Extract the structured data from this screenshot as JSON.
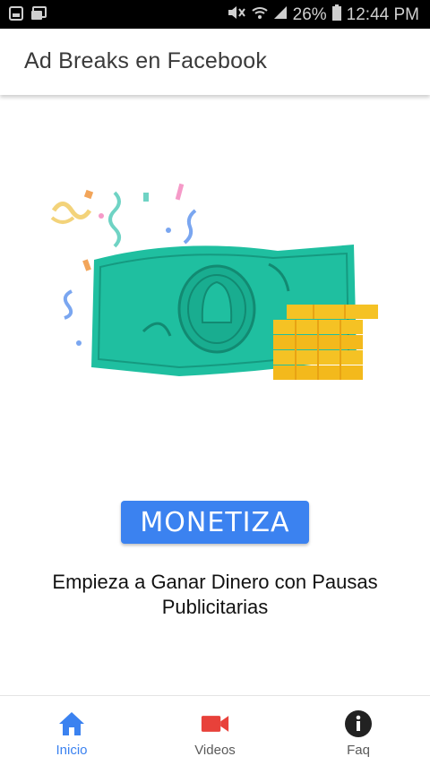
{
  "status_bar": {
    "battery": "26%",
    "time": "12:44 PM",
    "icons": [
      "image-icon",
      "cast-icon",
      "mute-icon",
      "wifi-icon",
      "signal-icon",
      "battery-icon"
    ]
  },
  "app_bar": {
    "title": "Ad Breaks en Facebook"
  },
  "illustration": {
    "icon": "money-bill-coins-illustration"
  },
  "cta": {
    "label": "MONETIZA"
  },
  "subtitle": {
    "line1": "Empieza a Ganar Dinero con Pausas",
    "line2": "Publicitarias"
  },
  "bottom_nav": {
    "items": [
      {
        "label": "Inicio",
        "icon": "home-icon",
        "active": true
      },
      {
        "label": "Videos",
        "icon": "video-camera-icon",
        "active": false
      },
      {
        "label": "Faq",
        "icon": "info-icon",
        "active": false
      }
    ]
  },
  "colors": {
    "accent": "#3b82f0",
    "video_icon": "#e8413a",
    "bill": "#1fbfa0",
    "coins": "#f5c224"
  }
}
